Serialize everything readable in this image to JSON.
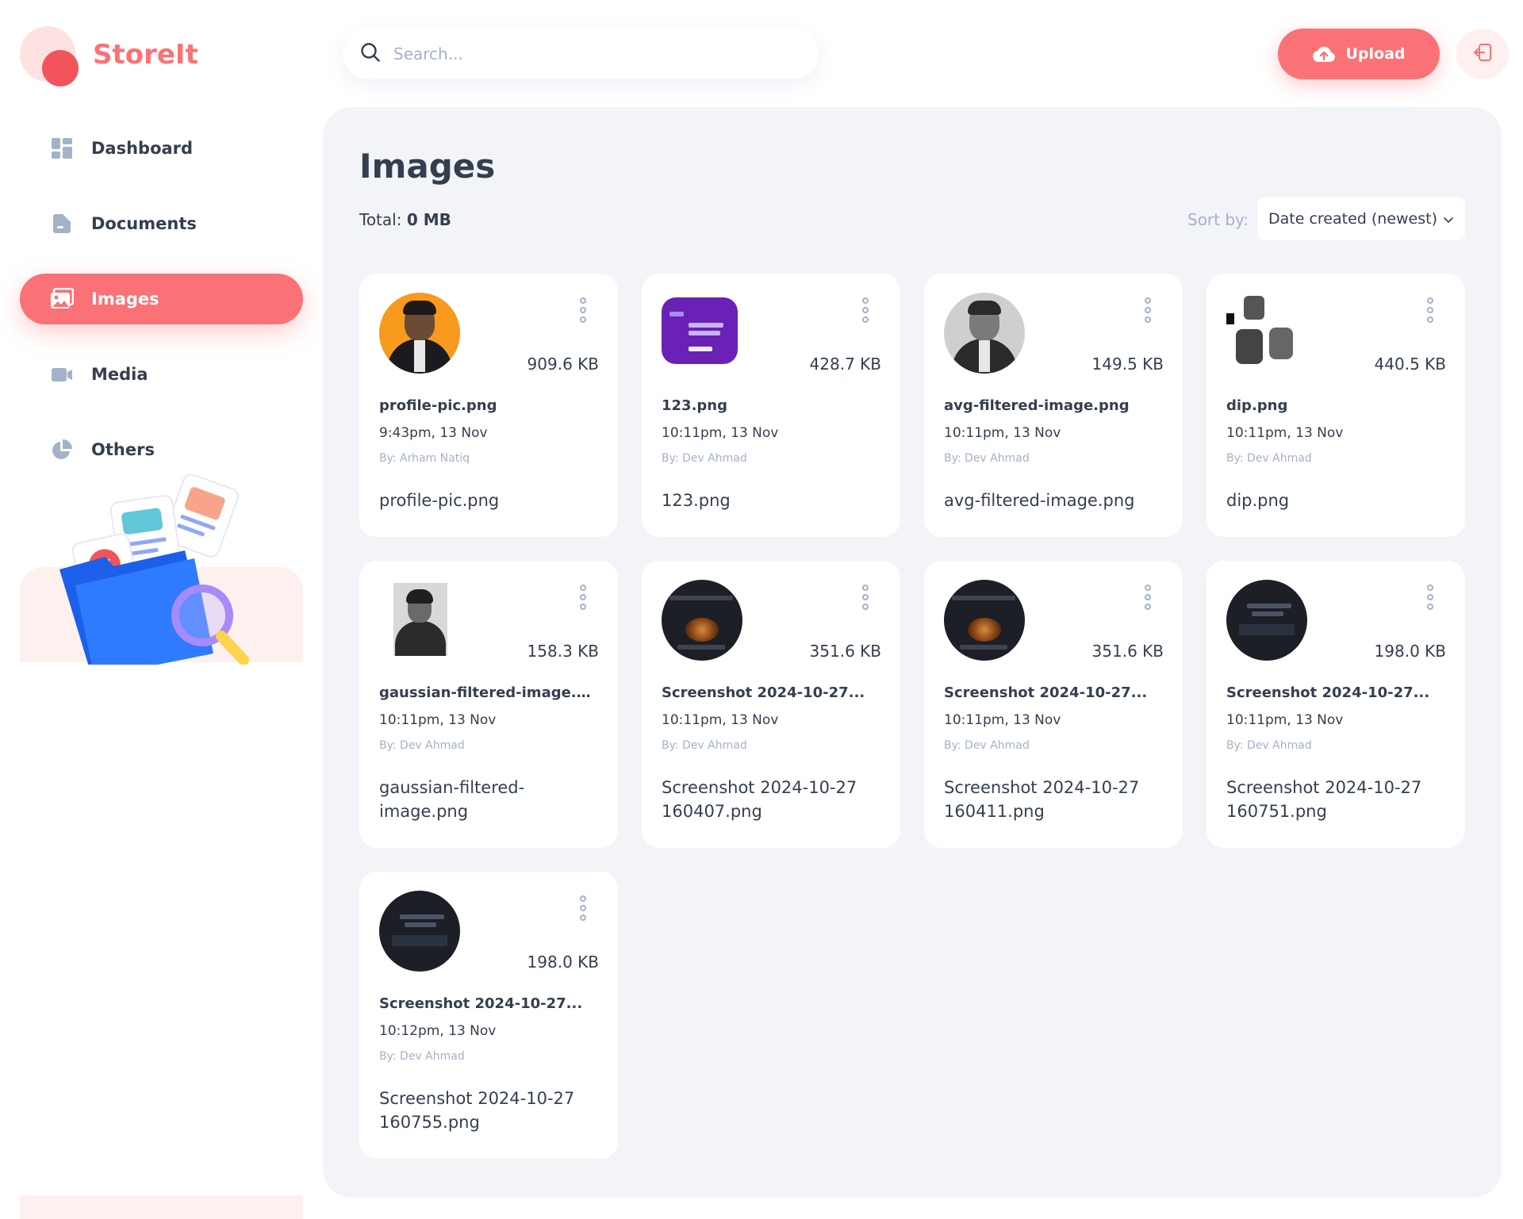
{
  "app": {
    "name": "StoreIt"
  },
  "sidebar": {
    "items": [
      {
        "label": "Dashboard",
        "icon": "dashboard-icon",
        "active": false
      },
      {
        "label": "Documents",
        "icon": "documents-icon",
        "active": false
      },
      {
        "label": "Images",
        "icon": "images-icon",
        "active": true
      },
      {
        "label": "Media",
        "icon": "media-icon",
        "active": false
      },
      {
        "label": "Others",
        "icon": "others-icon",
        "active": false
      }
    ]
  },
  "header": {
    "search_placeholder": "Search...",
    "upload_label": "Upload"
  },
  "page": {
    "title": "Images",
    "total_label": "Total:",
    "total_value": "0 MB",
    "sort_label": "Sort by:",
    "sort_value": "Date created (newest)"
  },
  "files": [
    {
      "name": "profile-pic.png",
      "size": "909.6 KB",
      "date": "9:43pm, 13 Nov",
      "by": "By: Arham Natiq",
      "full_name": "profile-pic.png"
    },
    {
      "name": "123.png",
      "size": "428.7 KB",
      "date": "10:11pm, 13 Nov",
      "by": "By: Dev Ahmad",
      "full_name": "123.png"
    },
    {
      "name": "avg-filtered-image.png",
      "size": "149.5 KB",
      "date": "10:11pm, 13 Nov",
      "by": "By: Dev Ahmad",
      "full_name": "avg-filtered-image.png"
    },
    {
      "name": "dip.png",
      "size": "440.5 KB",
      "date": "10:11pm, 13 Nov",
      "by": "By: Dev Ahmad",
      "full_name": "dip.png"
    },
    {
      "name": "gaussian-filtered-image.png",
      "size": "158.3 KB",
      "date": "10:11pm, 13 Nov",
      "by": "By: Dev Ahmad",
      "full_name": "gaussian-filtered-image.png"
    },
    {
      "name": "Screenshot 2024-10-27...",
      "size": "351.6 KB",
      "date": "10:11pm, 13 Nov",
      "by": "By: Dev Ahmad",
      "full_name": "Screenshot 2024-10-27 160407.png"
    },
    {
      "name": "Screenshot 2024-10-27...",
      "size": "351.6 KB",
      "date": "10:11pm, 13 Nov",
      "by": "By: Dev Ahmad",
      "full_name": "Screenshot 2024-10-27 160411.png"
    },
    {
      "name": "Screenshot 2024-10-27...",
      "size": "198.0 KB",
      "date": "10:11pm, 13 Nov",
      "by": "By: Dev Ahmad",
      "full_name": "Screenshot 2024-10-27 160751.png"
    },
    {
      "name": "Screenshot 2024-10-27...",
      "size": "198.0 KB",
      "date": "10:12pm, 13 Nov",
      "by": "By: Dev Ahmad",
      "full_name": "Screenshot 2024-10-27 160755.png"
    }
  ],
  "colors": {
    "brand": "#FA7275",
    "background": "#F2F4F8",
    "text": "#333F4E",
    "muted": "#A3B2C7"
  }
}
